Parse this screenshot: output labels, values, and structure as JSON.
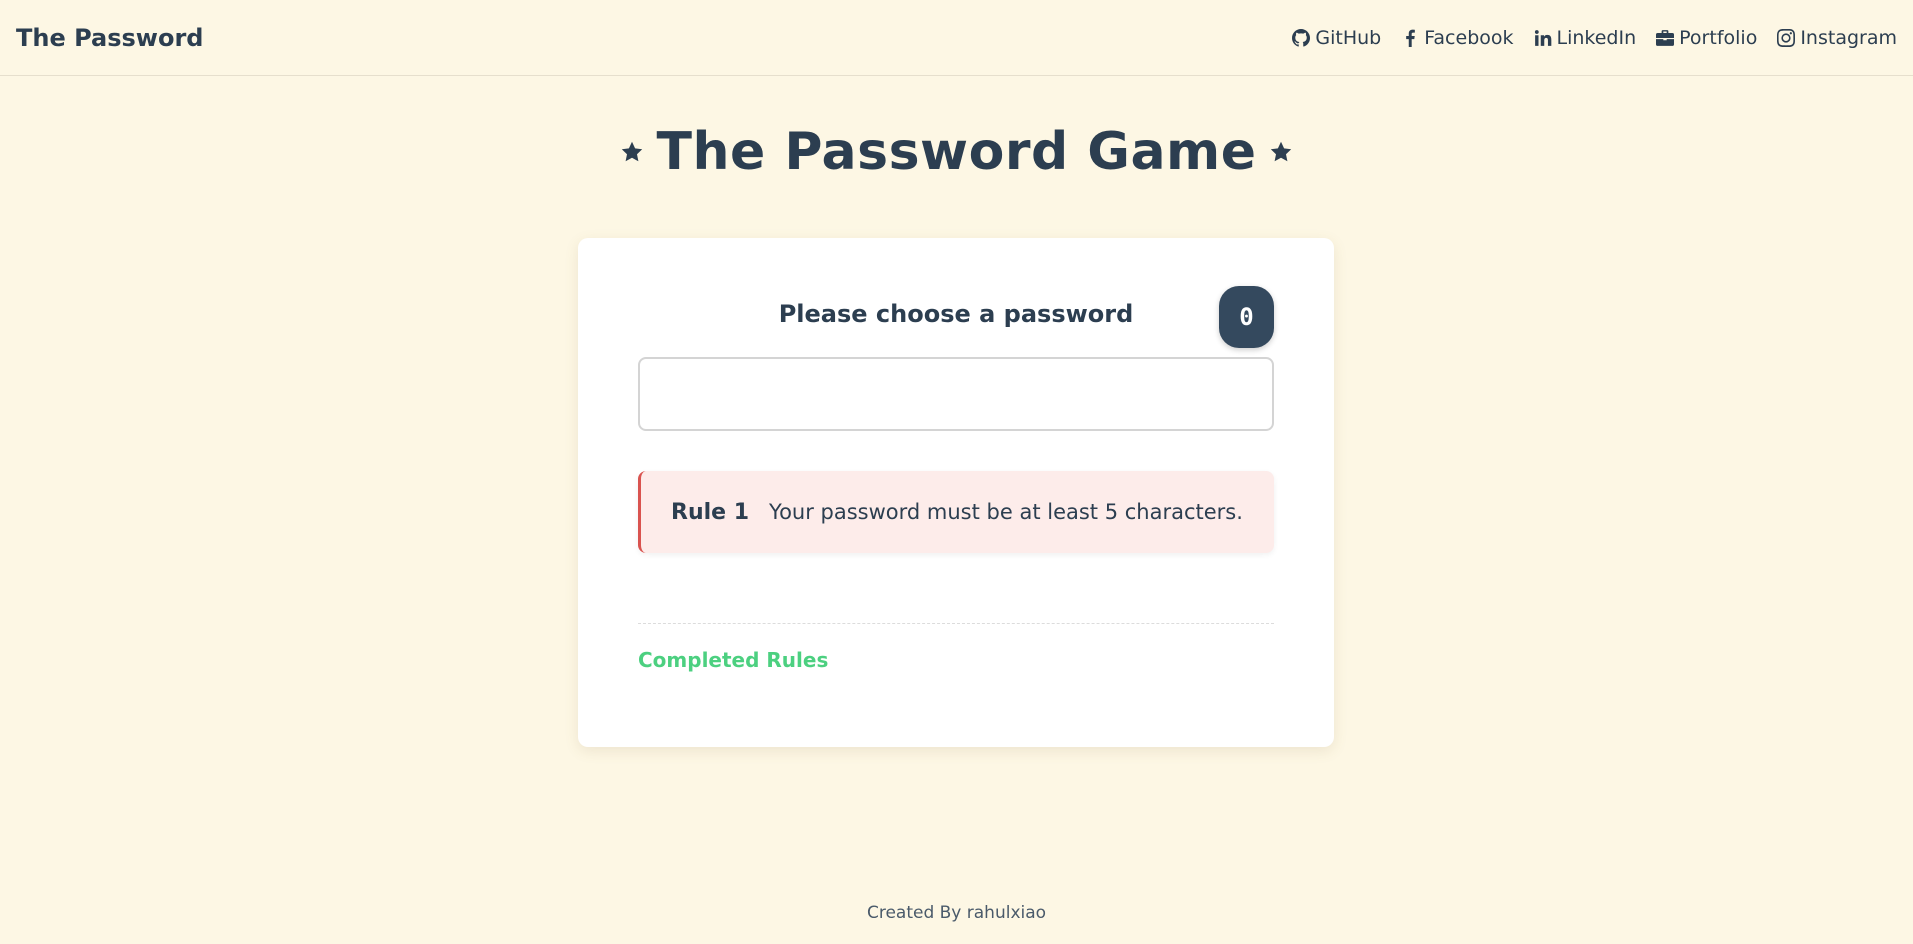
{
  "navbar": {
    "brand": "The Password",
    "links": [
      {
        "label": "GitHub",
        "icon": "github-icon"
      },
      {
        "label": "Facebook",
        "icon": "facebook-icon"
      },
      {
        "label": "LinkedIn",
        "icon": "linkedin-icon"
      },
      {
        "label": "Portfolio",
        "icon": "briefcase-icon"
      },
      {
        "label": "Instagram",
        "icon": "instagram-icon"
      }
    ]
  },
  "header": {
    "title": "The Password Game",
    "decoration_icon": "star-icon"
  },
  "game": {
    "prompt": "Please choose a password",
    "char_count": "0",
    "password_value": "",
    "password_placeholder": "",
    "rules": [
      {
        "number": "Rule 1",
        "text": "Your password must be at least 5 characters.",
        "status": "failing"
      }
    ],
    "completed_label": "Completed Rules"
  },
  "footer": {
    "credit": "Created By rahulxiao"
  },
  "colors": {
    "background": "#fdf7e4",
    "text": "#2c3e50",
    "rule_fail_bg": "#fdecea",
    "rule_fail_border": "#d9534f",
    "completed": "#4cd080",
    "counter_bg": "#34495e"
  }
}
